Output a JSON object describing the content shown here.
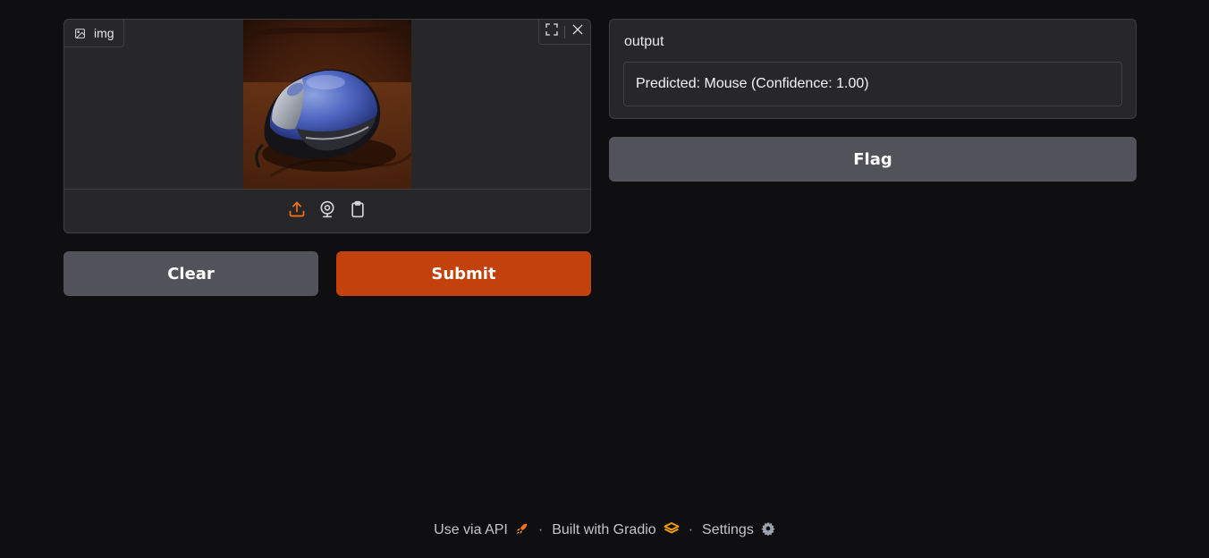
{
  "input": {
    "label": "img",
    "image_alt": "Photo of a blue and silver computer mouse on a wooden desk"
  },
  "buttons": {
    "clear": "Clear",
    "submit": "Submit",
    "flag": "Flag"
  },
  "output": {
    "label": "output",
    "value": "Predicted: Mouse (Confidence: 1.00)"
  },
  "footer": {
    "api": "Use via API",
    "built_with": "Built with Gradio",
    "settings": "Settings",
    "separator": "·"
  },
  "colors": {
    "background": "#0f0f11",
    "panel": "#27272a",
    "border": "#3f3f46",
    "primary": "#c2410c",
    "secondary": "#52525b",
    "accent_orange": "#f97316"
  }
}
